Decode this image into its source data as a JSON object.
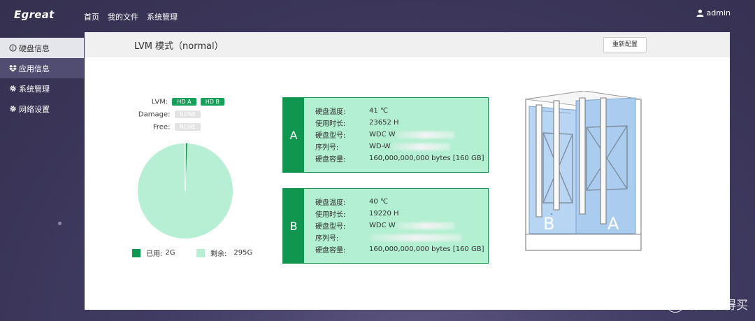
{
  "app": {
    "logo": "Egreat",
    "user": "admin"
  },
  "topnav": [
    "首页",
    "我的文件",
    "系统管理"
  ],
  "sidebar": [
    {
      "label": "硬盘信息",
      "icon": "info-icon"
    },
    {
      "label": "应用信息",
      "icon": "dropbox-icon"
    },
    {
      "label": "系统管理",
      "icon": "gear-icon"
    },
    {
      "label": "网络设置",
      "icon": "gear-icon"
    }
  ],
  "panel": {
    "title": "LVM 模式（normal）",
    "reconfigure_button": "重新配置"
  },
  "status": {
    "lvm_label": "LVM:",
    "lvm_tags": [
      "HD A",
      "HD B"
    ],
    "damage_label": "Damage:",
    "damage_tag": "NONE",
    "free_label": "Free:",
    "free_tag": "NONE"
  },
  "usage": {
    "used_label": "已用:",
    "used_value": "2G",
    "remaining_label": "剩余:",
    "remaining_value": "295G"
  },
  "chart_data": {
    "type": "pie",
    "categories": [
      "已用",
      "剩余"
    ],
    "values": [
      2,
      295
    ],
    "colors": [
      "#0e9852",
      "#b6efd3"
    ]
  },
  "disks": [
    {
      "letter": "A",
      "rows": [
        {
          "key": "硬盘温度:",
          "value": "41 ℃"
        },
        {
          "key": "使用时长:",
          "value": "23652 H"
        },
        {
          "key": "硬盘型号:",
          "value": "WDC W"
        },
        {
          "key": "序列号:",
          "value": "WD-W"
        },
        {
          "key": "硬盘容量:",
          "value": "160,000,000,000 bytes [160 GB]"
        }
      ]
    },
    {
      "letter": "B",
      "rows": [
        {
          "key": "硬盘温度:",
          "value": "40 ℃"
        },
        {
          "key": "使用时长:",
          "value": "19220 H"
        },
        {
          "key": "硬盘型号:",
          "value": "WDC W"
        },
        {
          "key": "序列号:",
          "value": ""
        },
        {
          "key": "硬盘容量:",
          "value": "160,000,000,000 bytes [160 GB]"
        }
      ]
    }
  ],
  "nas_labels": {
    "bay_b": "B",
    "bay_a": "A"
  },
  "watermark": {
    "badge": "值",
    "text": "什么值得买"
  },
  "colors": {
    "accent_green": "#10964f",
    "card_bg": "#b3efd1",
    "pie_remaining": "#b6efd3",
    "pie_used": "#0e9852"
  }
}
